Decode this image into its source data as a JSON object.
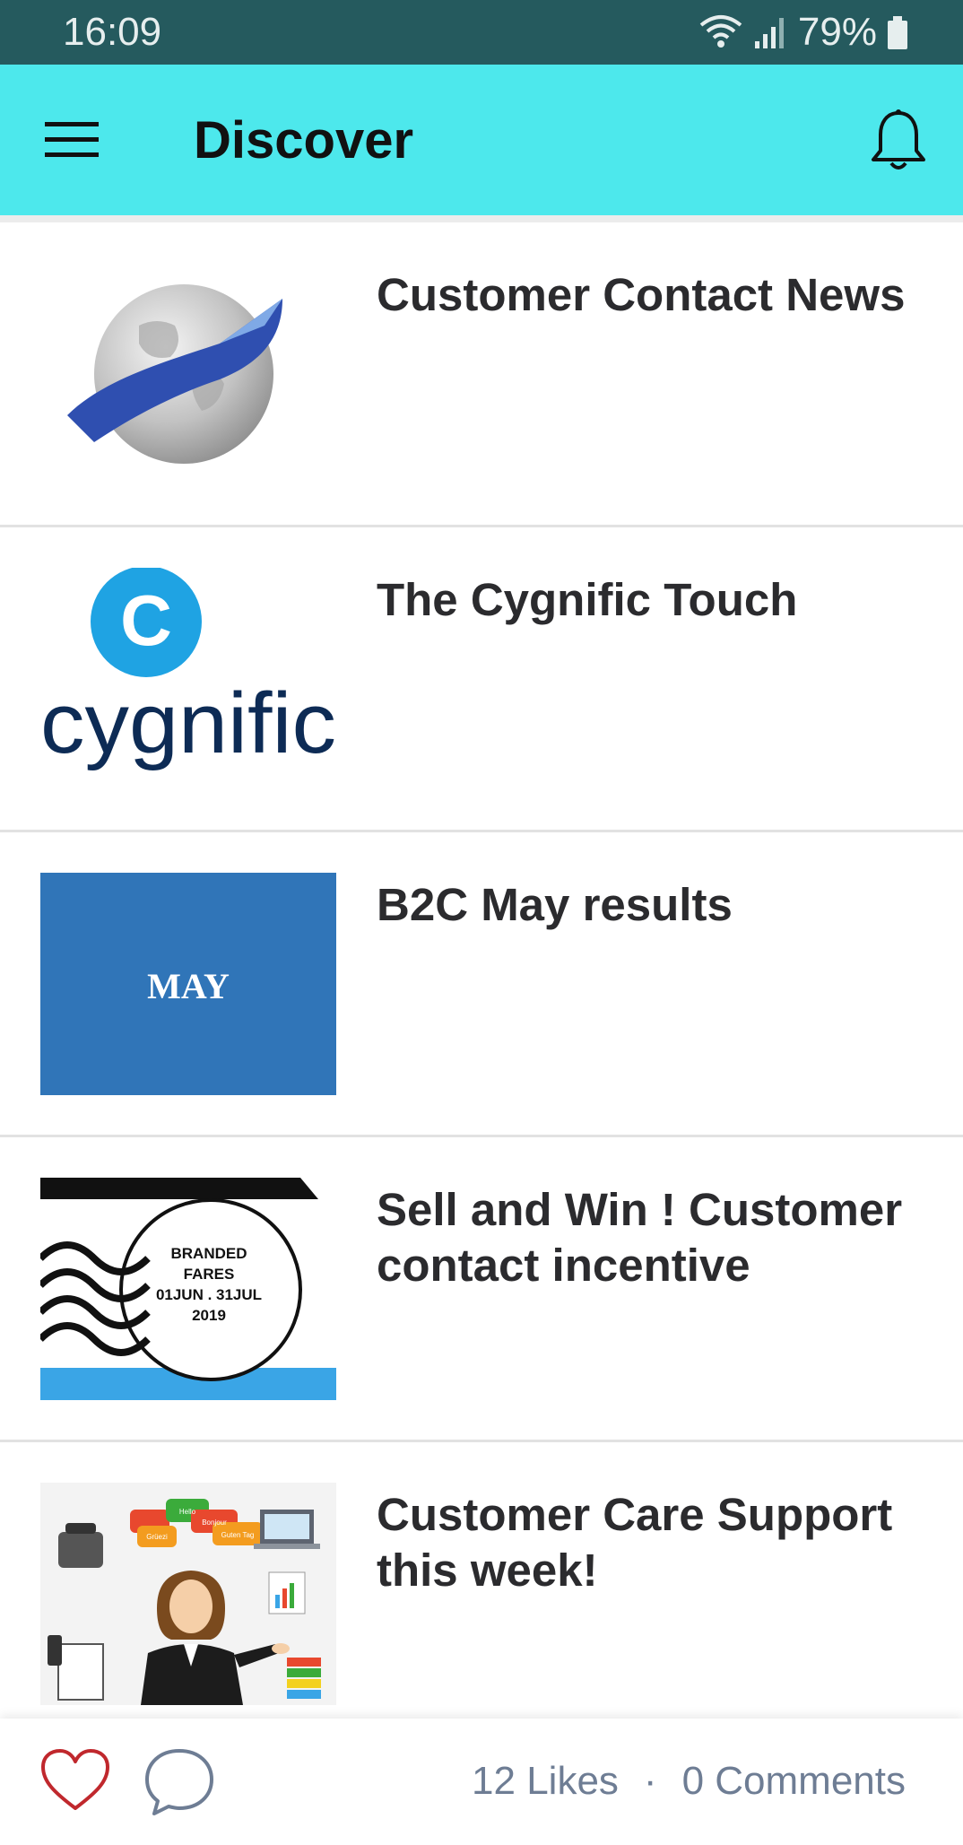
{
  "status_bar": {
    "time": "16:09",
    "battery_percent": "79%"
  },
  "app_bar": {
    "title": "Discover",
    "menu_icon": "hamburger-menu-icon",
    "notifications_icon": "bell-icon"
  },
  "feed": {
    "items": [
      {
        "title": "Customer Contact News",
        "thumbnail": "globe-logo"
      },
      {
        "title": "The Cygnific Touch",
        "thumbnail": "cygnific-logo",
        "logo_text": "cygnific",
        "logo_letter": "C"
      },
      {
        "title": "B2C May results",
        "thumbnail": "may-banner",
        "thumb_text": "MAY"
      },
      {
        "title": "Sell and Win ! Customer contact incentive",
        "thumbnail": "branded-fares-stamp",
        "stamp_lines": [
          "BRANDED",
          "FARES",
          "01JUN . 31JUL",
          "2019"
        ]
      },
      {
        "title": "Customer Care Support this week!",
        "thumbnail": "customer-care-illustration",
        "bubbles": [
          "Hello",
          "Bonjour",
          "Grüezi",
          "Guten Tag"
        ]
      }
    ]
  },
  "bottom_bar": {
    "likes": "12 Likes",
    "separator": "·",
    "comments": "0 Comments"
  },
  "colors": {
    "status_bar": "#255a5e",
    "app_bar": "#4de8ec",
    "accent_red": "#c0282d",
    "muted_text": "#6e7d94"
  }
}
